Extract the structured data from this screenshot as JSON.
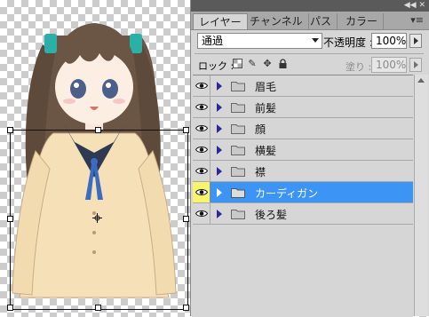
{
  "panel": {
    "tabs": [
      {
        "label": "レイヤー",
        "active": true
      },
      {
        "label": "チャンネル",
        "active": false
      },
      {
        "label": "パス",
        "active": false
      },
      {
        "label": "カラー",
        "active": false
      }
    ],
    "blend_mode": "通過",
    "opacity_label": "不透明度 :",
    "opacity_value": "100%",
    "lock_label": "ロック :",
    "fill_label": "塗り :",
    "fill_value": "100%"
  },
  "layers": [
    {
      "name": "眉毛",
      "type": "group",
      "visible": true,
      "selected": false
    },
    {
      "name": "前髪",
      "type": "group",
      "visible": true,
      "selected": false
    },
    {
      "name": "顔",
      "type": "group",
      "visible": true,
      "selected": false
    },
    {
      "name": "横髪",
      "type": "group",
      "visible": true,
      "selected": false
    },
    {
      "name": "襟",
      "type": "group",
      "visible": true,
      "selected": false
    },
    {
      "name": "カーディガン",
      "type": "group",
      "visible": true,
      "selected": true
    },
    {
      "name": "後ろ髪",
      "type": "group",
      "visible": true,
      "selected": false
    }
  ],
  "colors": {
    "selection": "#3c94f5",
    "eye_highlight": "#f8f56c",
    "panel_bg": "#d6d6d6"
  },
  "icons": [
    "eye-icon",
    "folder-icon",
    "expand-triangle-icon",
    "lock-transparent-icon",
    "lock-paint-icon",
    "lock-move-icon",
    "lock-all-icon",
    "panel-menu-icon"
  ]
}
